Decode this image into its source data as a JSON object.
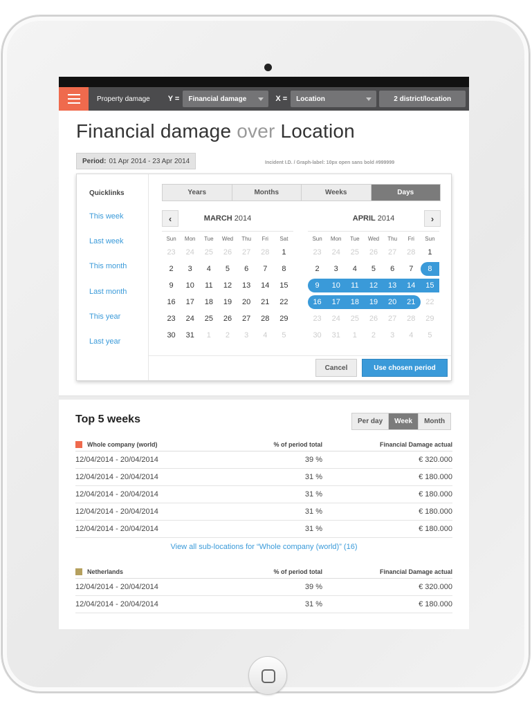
{
  "toolbar": {
    "title": "Property damage",
    "y_axis_label": "Y =",
    "y_value": "Financial damage",
    "x_axis_label": "X =",
    "x_value": "Location",
    "scope_button": "2 district/location"
  },
  "page": {
    "title_part1": "Financial damage",
    "title_part2": "over",
    "title_part3": "Location",
    "period_label": "Period:",
    "period_value": "01 Apr 2014 - 23 Apr 2014",
    "incident_note": "Incident I.D. / Graph-label: 10px open sans bold #999999"
  },
  "picker": {
    "quicklinks_title": "Quicklinks",
    "quicklinks": [
      "This week",
      "Last week",
      "This month",
      "Last month",
      "This year",
      "Last year"
    ],
    "granularity": [
      "Years",
      "Months",
      "Weeks",
      "Days"
    ],
    "granularity_active": "Days",
    "weekdays": [
      "Sun",
      "Mon",
      "Tue",
      "Wed",
      "Thu",
      "Fri",
      "Sat"
    ],
    "weekdays_april": [
      "Sun",
      "Mon",
      "Tue",
      "Wed",
      "Thu",
      "Fri",
      "Sun"
    ],
    "march": {
      "month": "MARCH",
      "year": "2014",
      "days": [
        [
          "23",
          "m"
        ],
        [
          "24",
          "m"
        ],
        [
          "25",
          "m"
        ],
        [
          "26",
          "m"
        ],
        [
          "27",
          "m"
        ],
        [
          "28",
          "m"
        ],
        [
          "1",
          ""
        ],
        [
          "2",
          ""
        ],
        [
          "3",
          ""
        ],
        [
          "4",
          ""
        ],
        [
          "5",
          ""
        ],
        [
          "6",
          ""
        ],
        [
          "7",
          ""
        ],
        [
          "8",
          ""
        ],
        [
          "9",
          ""
        ],
        [
          "10",
          ""
        ],
        [
          "11",
          ""
        ],
        [
          "12",
          ""
        ],
        [
          "13",
          ""
        ],
        [
          "14",
          ""
        ],
        [
          "15",
          ""
        ],
        [
          "16",
          ""
        ],
        [
          "17",
          ""
        ],
        [
          "18",
          ""
        ],
        [
          "19",
          ""
        ],
        [
          "20",
          ""
        ],
        [
          "21",
          ""
        ],
        [
          "22",
          ""
        ],
        [
          "23",
          ""
        ],
        [
          "24",
          ""
        ],
        [
          "25",
          ""
        ],
        [
          "26",
          ""
        ],
        [
          "27",
          ""
        ],
        [
          "28",
          ""
        ],
        [
          "29",
          ""
        ],
        [
          "30",
          ""
        ],
        [
          "31",
          ""
        ],
        [
          "1",
          "m"
        ],
        [
          "2",
          "m"
        ],
        [
          "3",
          "m"
        ],
        [
          "4",
          "m"
        ],
        [
          "5",
          "m"
        ]
      ]
    },
    "april": {
      "month": "APRIL",
      "year": "2014",
      "days": [
        [
          "23",
          "m"
        ],
        [
          "24",
          "m"
        ],
        [
          "25",
          "m"
        ],
        [
          "26",
          "m"
        ],
        [
          "27",
          "m"
        ],
        [
          "28",
          "m"
        ],
        [
          "1",
          ""
        ],
        [
          "2",
          ""
        ],
        [
          "3",
          ""
        ],
        [
          "4",
          ""
        ],
        [
          "5",
          ""
        ],
        [
          "6",
          ""
        ],
        [
          "7",
          ""
        ],
        [
          "8",
          "s-start"
        ],
        [
          "9",
          "s-start"
        ],
        [
          "10",
          "s"
        ],
        [
          "11",
          "s"
        ],
        [
          "12",
          "s"
        ],
        [
          "13",
          "s"
        ],
        [
          "14",
          "s"
        ],
        [
          "15",
          "s"
        ],
        [
          "16",
          "s-start"
        ],
        [
          "17",
          "s"
        ],
        [
          "18",
          "s"
        ],
        [
          "19",
          "s"
        ],
        [
          "20",
          "s"
        ],
        [
          "21",
          "s-end"
        ],
        [
          "22",
          "m"
        ],
        [
          "23",
          "m"
        ],
        [
          "24",
          "m"
        ],
        [
          "25",
          "m"
        ],
        [
          "26",
          "m"
        ],
        [
          "27",
          "m"
        ],
        [
          "28",
          "m"
        ],
        [
          "29",
          "m"
        ],
        [
          "30",
          "m"
        ],
        [
          "31",
          "m"
        ],
        [
          "1",
          "m"
        ],
        [
          "2",
          "m"
        ],
        [
          "3",
          "m"
        ],
        [
          "4",
          "m"
        ],
        [
          "5",
          "m"
        ]
      ]
    },
    "cancel": "Cancel",
    "use_period": "Use chosen period"
  },
  "top5": {
    "title": "Top 5 weeks",
    "toggle": [
      "Per day",
      "Week",
      "Month"
    ],
    "toggle_active": "Week",
    "colors": {
      "whole_company": "#ef6a4d",
      "netherlands": "#b5a05e",
      "link": "#3a9ad9"
    },
    "groups": [
      {
        "name": "Whole company (world)",
        "col2": "% of period total",
        "col3": "Financial Damage actual",
        "rows": [
          [
            "12/04/2014 - 20/04/2014",
            "39 %",
            "€ 320.000"
          ],
          [
            "12/04/2014 - 20/04/2014",
            "31 %",
            "€ 180.000"
          ],
          [
            "12/04/2014 - 20/04/2014",
            "31 %",
            "€ 180.000"
          ],
          [
            "12/04/2014 - 20/04/2014",
            "31 %",
            "€ 180.000"
          ],
          [
            "12/04/2014 - 20/04/2014",
            "31 %",
            "€ 180.000"
          ]
        ],
        "view_all": "View all sub-locations for “Whole company (world)”  (16)"
      },
      {
        "name": "Netherlands",
        "col2": "% of period total",
        "col3": "Financial Damage actual",
        "rows": [
          [
            "12/04/2014 - 20/04/2014",
            "39 %",
            "€ 320.000"
          ],
          [
            "12/04/2014 - 20/04/2014",
            "31 %",
            "€ 180.000"
          ]
        ]
      }
    ]
  }
}
